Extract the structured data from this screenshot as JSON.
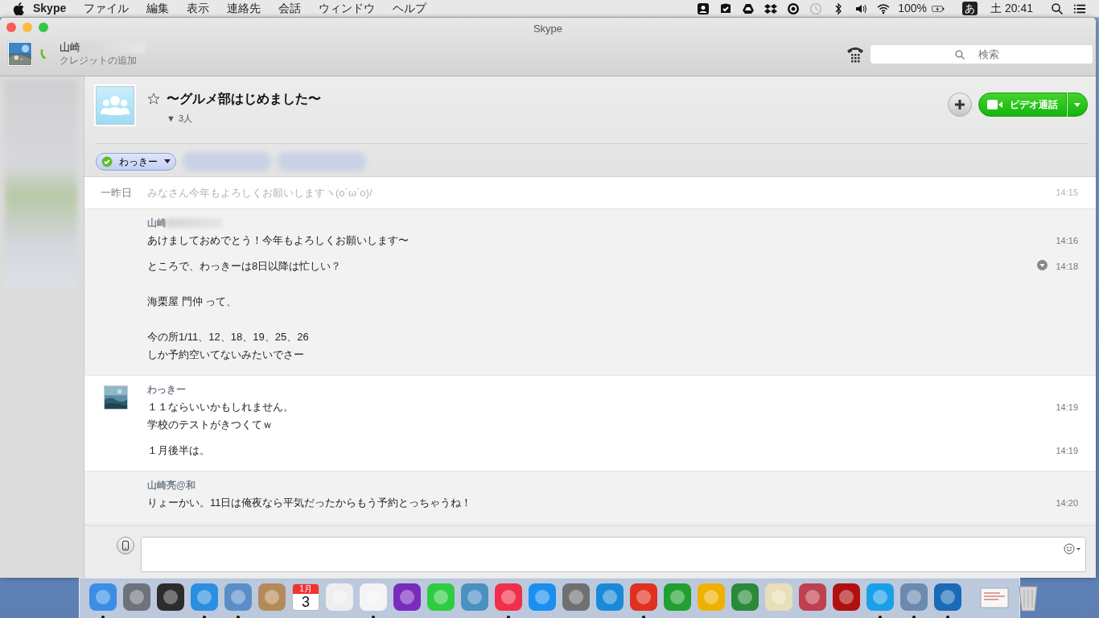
{
  "menubar": {
    "app": "Skype",
    "items": [
      "ファイル",
      "編集",
      "表示",
      "連絡先",
      "会話",
      "ウィンドウ",
      "ヘルプ"
    ],
    "battery": "100%",
    "input_method": "あ",
    "clock": "土 20:41"
  },
  "window": {
    "title": "Skype"
  },
  "profile": {
    "name": "山崎",
    "name_redacted": true,
    "credit_link": "クレジットの追加"
  },
  "search": {
    "placeholder": "検索"
  },
  "conversation": {
    "title": "〜グルメ部はじめました〜",
    "starred": false,
    "members_toggle": "▼",
    "members": "3人",
    "video_button": "ビデオ通話"
  },
  "participants": [
    {
      "name": "わっきー",
      "redacted": false
    },
    {
      "redacted": true
    },
    {
      "redacted": true
    }
  ],
  "messages": [
    {
      "kind": "history",
      "date": "一昨日",
      "text": "みなさん今年もよろしくお願いしますヽ(o´ω`o)/",
      "time": "14:15"
    },
    {
      "kind": "group",
      "own": true,
      "sender": "山崎",
      "sender_redacted": true,
      "avatar": false,
      "lines": [
        {
          "paragraphs": [
            [
              "あけましておめでとう！今年もよろしくお願いします〜"
            ]
          ],
          "time": "14:16",
          "menu": false
        },
        {
          "paragraphs": [
            [
              "ところで、わっきーは8日以降は忙しい？"
            ],
            [
              "海栗屋 門仲 って、"
            ],
            [
              "今の所1/11、12、18、19、25、26",
              "しか予約空いてないみたいでさー"
            ]
          ],
          "time": "14:18",
          "menu": true
        }
      ]
    },
    {
      "kind": "group",
      "own": false,
      "sender": "わっきー",
      "sender_redacted": false,
      "avatar": true,
      "lines": [
        {
          "paragraphs": [
            [
              "１１ならいいかもしれません。",
              "学校のテストがきつくてｗ"
            ]
          ],
          "time": "14:19",
          "menu": false
        },
        {
          "paragraphs": [
            [
              "１月後半は。"
            ]
          ],
          "time": "14:19",
          "menu": false
        }
      ]
    },
    {
      "kind": "group",
      "own": true,
      "sender": "山崎亮@和",
      "sender_redacted": false,
      "avatar": false,
      "lines": [
        {
          "paragraphs": [
            [
              "りょーかい。11日は俺夜なら平気だったからもう予約とっちゃうね！"
            ]
          ],
          "time": "14:20",
          "menu": false
        }
      ]
    }
  ],
  "dock": [
    {
      "kind": "app",
      "color": "#3a8ee6",
      "running": true
    },
    {
      "kind": "app",
      "color": "#6d737b",
      "running": false
    },
    {
      "kind": "app",
      "color": "#2c2c2c",
      "running": false
    },
    {
      "kind": "app",
      "color": "#2a8fe0",
      "running": true
    },
    {
      "kind": "app",
      "color": "#5a8ec8",
      "running": true
    },
    {
      "kind": "app",
      "color": "#b58a5a",
      "running": false
    },
    {
      "kind": "calendar",
      "month": "1月",
      "day": "3",
      "running": false
    },
    {
      "kind": "app",
      "color": "#eeeeee",
      "running": false
    },
    {
      "kind": "app",
      "color": "#f4f4f4",
      "running": true
    },
    {
      "kind": "app",
      "color": "#7a2bbd",
      "running": false
    },
    {
      "kind": "app",
      "color": "#2ecc40",
      "running": false
    },
    {
      "kind": "app",
      "color": "#4a90c0",
      "running": false
    },
    {
      "kind": "app",
      "color": "#f0304a",
      "running": true
    },
    {
      "kind": "app",
      "color": "#1a8ff0",
      "running": false
    },
    {
      "kind": "app",
      "color": "#707070",
      "running": false
    },
    {
      "kind": "app",
      "color": "#1a8ad8",
      "running": false
    },
    {
      "kind": "app",
      "color": "#e03020",
      "running": true
    },
    {
      "kind": "app",
      "color": "#20a030",
      "running": false
    },
    {
      "kind": "app",
      "color": "#f0b000",
      "running": false
    },
    {
      "kind": "app",
      "color": "#2a8a3a",
      "running": false
    },
    {
      "kind": "app",
      "color": "#e8dfb8",
      "running": false
    },
    {
      "kind": "app",
      "color": "#c04050",
      "running": false
    },
    {
      "kind": "app",
      "color": "#b01010",
      "running": false
    },
    {
      "kind": "app",
      "color": "#1aa0e8",
      "running": true
    },
    {
      "kind": "app",
      "color": "#6a8ab0",
      "running": true
    },
    {
      "kind": "app",
      "color": "#1a6ab8",
      "running": true
    },
    {
      "kind": "separator"
    },
    {
      "kind": "document",
      "running": false
    },
    {
      "kind": "trash",
      "running": false
    }
  ]
}
